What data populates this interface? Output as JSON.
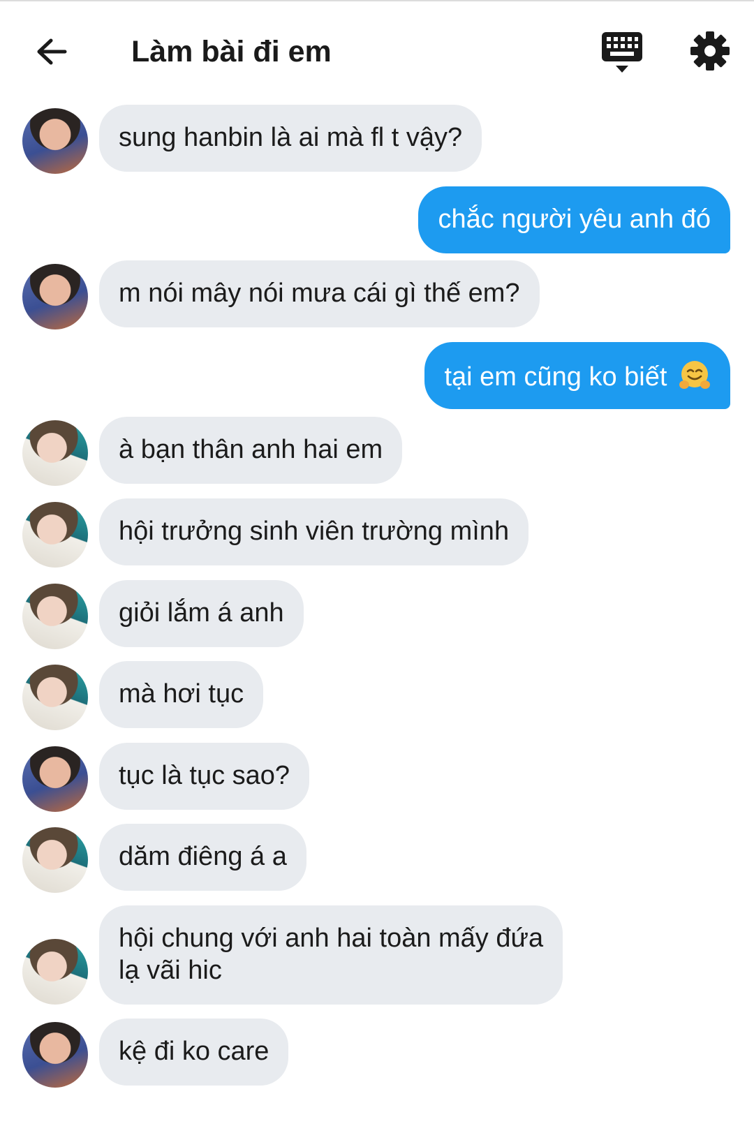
{
  "header": {
    "title": "Làm bài đi em",
    "back_icon": "arrow-left-icon",
    "keyboard_icon": "keyboard-icon",
    "settings_icon": "gear-icon"
  },
  "colors": {
    "accent": "#1d9bf0",
    "incoming_bubble": "#e8ebef",
    "text": "#1a1a1a"
  },
  "messages": [
    {
      "side": "in",
      "avatar": "avatar-a",
      "text": "sung hanbin là ai mà fl t vậy?"
    },
    {
      "side": "out",
      "text": "chắc người yêu anh đó"
    },
    {
      "side": "in",
      "avatar": "avatar-a",
      "text": "m nói mây nói mưa cái gì thế em?"
    },
    {
      "side": "out",
      "text": "tại em cũng ko biết",
      "emoji": "hugging-face-emoji"
    },
    {
      "side": "in",
      "avatar": "avatar-b",
      "text": "à bạn thân anh hai em"
    },
    {
      "side": "in",
      "avatar": "avatar-b",
      "text": "hội trưởng sinh viên trường mình"
    },
    {
      "side": "in",
      "avatar": "avatar-b",
      "text": "giỏi lắm á anh"
    },
    {
      "side": "in",
      "avatar": "avatar-b",
      "text": "mà hơi tục"
    },
    {
      "side": "in",
      "avatar": "avatar-a",
      "text": "tục là tục sao?"
    },
    {
      "side": "in",
      "avatar": "avatar-b",
      "text": "dăm điêng á a"
    },
    {
      "side": "in",
      "avatar": "avatar-b",
      "line1": "hội chung với anh hai toàn mấy đứa",
      "line2": "lạ vãi hic"
    },
    {
      "side": "in",
      "avatar": "avatar-a",
      "text": "kệ đi ko care"
    }
  ]
}
